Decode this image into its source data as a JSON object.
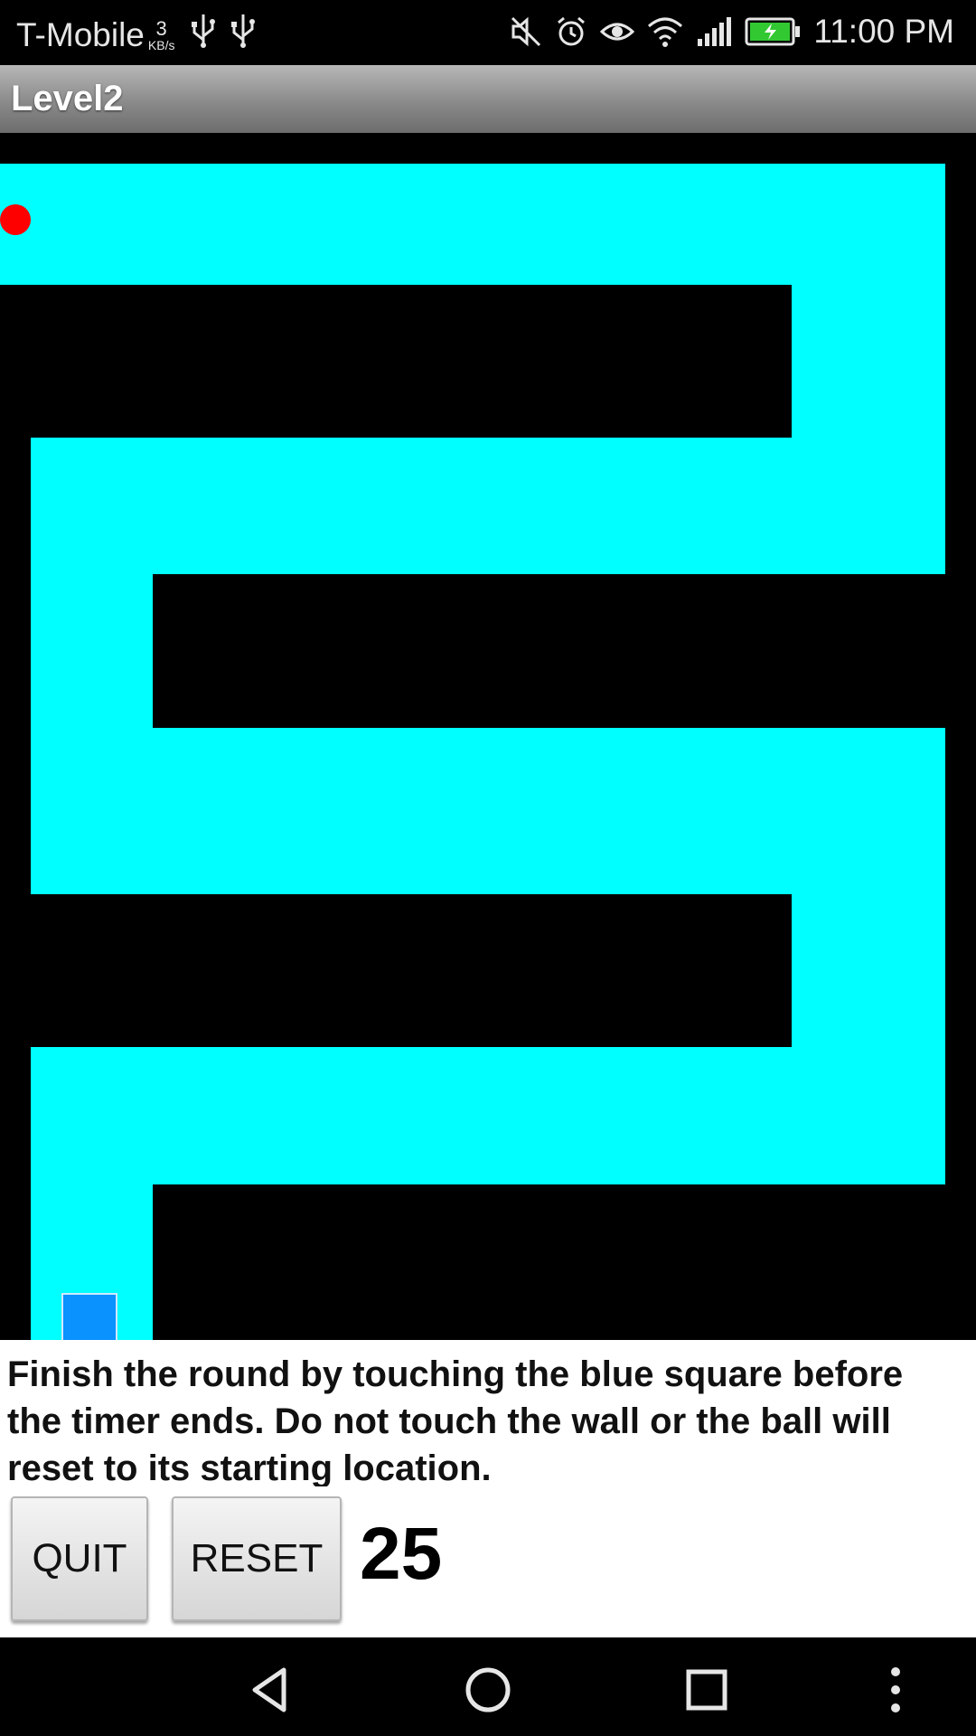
{
  "status_bar": {
    "carrier": "T-Mobile",
    "net_speed_value": "3",
    "net_speed_unit": "KB/s",
    "time": "11:00 PM",
    "icons": [
      "usb-icon",
      "usb-icon",
      "mute-icon",
      "alarm-icon",
      "eye-icon",
      "wifi-icon",
      "signal-icon",
      "battery-charging-icon"
    ]
  },
  "title_bar": {
    "title": "Level2"
  },
  "game": {
    "path_color": "#00ffff",
    "wall_color": "#000000",
    "ball_color": "#ff0000",
    "goal_color": "#0a92ff"
  },
  "panel": {
    "instructions": "Finish the round by touching the blue square before the timer ends. Do not touch the wall or the ball will reset to its starting location.",
    "quit_label": "QUIT",
    "reset_label": "RESET",
    "timer": "25"
  },
  "nav_bar": {
    "icons": [
      "back-icon",
      "home-icon",
      "recents-icon",
      "more-options-icon"
    ]
  }
}
